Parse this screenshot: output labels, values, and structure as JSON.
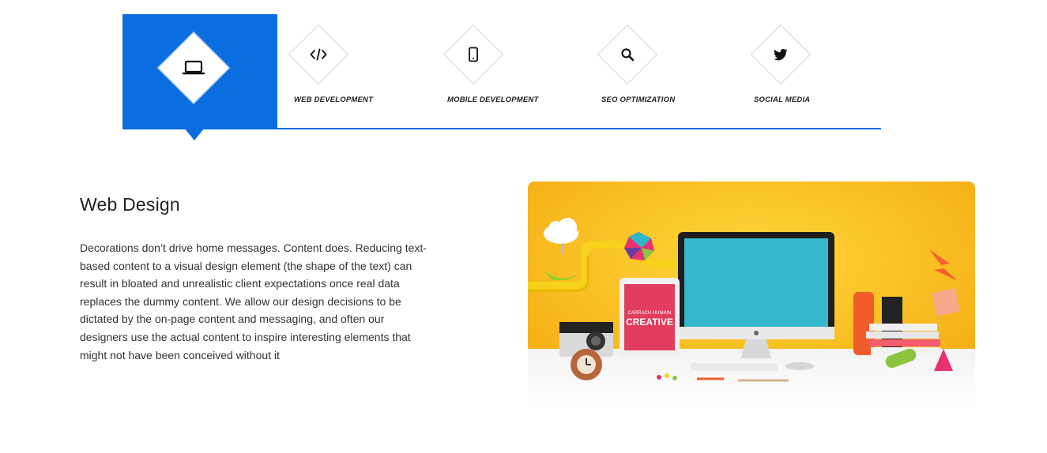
{
  "tabs": [
    {
      "label": "",
      "icon": "laptop-icon",
      "active": true
    },
    {
      "label": "WEB DEVELOPMENT",
      "icon": "code-icon",
      "active": false
    },
    {
      "label": "MOBILE DEVELOPMENT",
      "icon": "mobile-icon",
      "active": false
    },
    {
      "label": "SEO OPTIMIZATION",
      "icon": "search-icon",
      "active": false
    },
    {
      "label": "SOCIAL MEDIA",
      "icon": "twitter-icon",
      "active": false
    }
  ],
  "content": {
    "title": "Web Design",
    "description": "Decorations don’t drive home messages. Content does. Reducing text-based content to a visual design element (the shape of the text) can result in bloated and unrealistic client expectations once real data replaces the dummy content. We allow our design decisions to be dictated by the on-page content and messaging, and often our designers use the actual content to inspire interesting elements that might not have been conceived without it"
  },
  "hero_image": {
    "tablet_text_top": "CARRACH HUMAIN",
    "tablet_text_main": "CREATIVE"
  },
  "colors": {
    "accent": "#0a6ee0",
    "hero_background": "#f7c51b",
    "screen": "#35b7cc"
  }
}
